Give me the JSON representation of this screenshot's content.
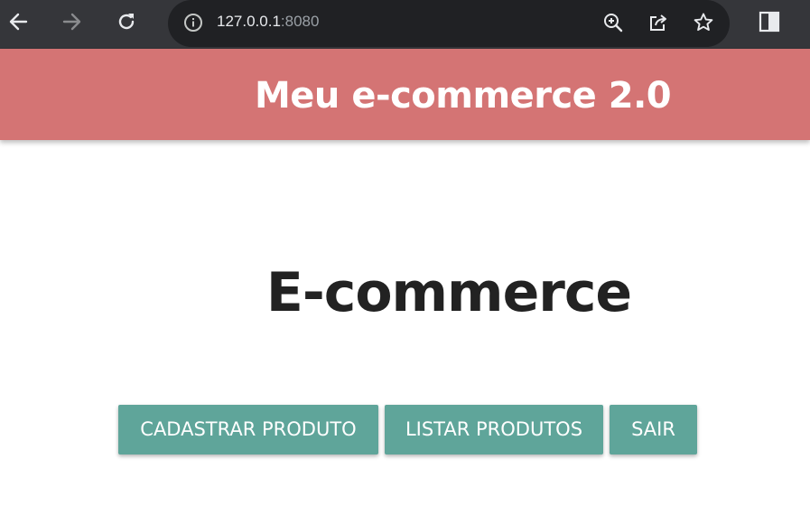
{
  "browser": {
    "url_host": "127.0.0.1",
    "url_port": ":8080",
    "icons": {
      "back": "arrow-left-icon",
      "forward": "arrow-right-icon",
      "reload": "reload-icon",
      "info": "info-icon",
      "zoom": "zoom-in-icon",
      "share": "share-icon",
      "bookmark": "star-icon",
      "side_panel": "side-panel-icon"
    },
    "colors": {
      "chrome": "#35363a",
      "omnibox": "#202124"
    }
  },
  "header": {
    "title": "Meu e-commerce 2.0",
    "color": "#d47474"
  },
  "main": {
    "heading": "E-commerce",
    "buttons": {
      "cadastrar": "CADASTRAR PRODUTO",
      "listar": "LISTAR PRODUTOS",
      "sair": "SAIR"
    },
    "button_color": "#5fa59a"
  }
}
